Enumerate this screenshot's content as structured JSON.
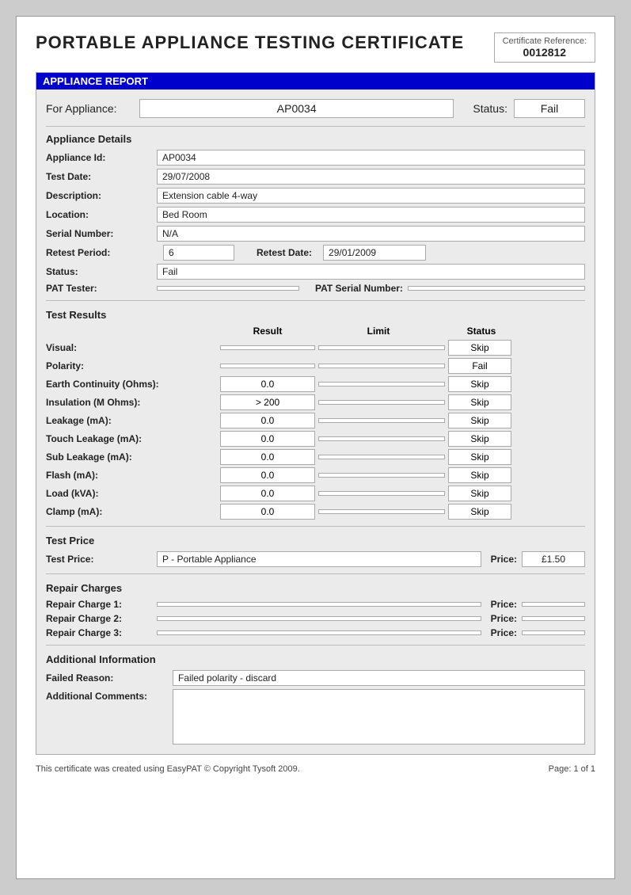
{
  "page": {
    "main_title": "PORTABLE APPLIANCE TESTING CERTIFICATE",
    "cert_ref_label": "Certificate Reference:",
    "cert_ref_value": "0012812",
    "footer_left": "This certificate was created using EasyPAT © Copyright Tysoft 2009.",
    "footer_right": "Page: 1 of 1"
  },
  "appliance_report": {
    "section_header": "APPLIANCE REPORT",
    "for_appliance_label": "For Appliance:",
    "for_appliance_value": "AP0034",
    "status_label": "Status:",
    "status_value": "Fail",
    "details_title": "Appliance Details",
    "appliance_id_label": "Appliance Id:",
    "appliance_id_value": "AP0034",
    "test_date_label": "Test Date:",
    "test_date_value": "29/07/2008",
    "description_label": "Description:",
    "description_value": "Extension cable 4-way",
    "location_label": "Location:",
    "location_value": "Bed Room",
    "serial_number_label": "Serial Number:",
    "serial_number_value": "N/A",
    "retest_period_label": "Retest Period:",
    "retest_period_value": "6",
    "retest_date_label": "Retest Date:",
    "retest_date_value": "29/01/2009",
    "status_field_label": "Status:",
    "status_field_value": "Fail",
    "pat_tester_label": "PAT Tester:",
    "pat_tester_value": "",
    "pat_serial_label": "PAT Serial Number:",
    "pat_serial_value": ""
  },
  "test_results": {
    "section_title": "Test Results",
    "col_result": "Result",
    "col_limit": "Limit",
    "col_status": "Status",
    "rows": [
      {
        "label": "Visual:",
        "result": "",
        "limit": "",
        "status": "Skip"
      },
      {
        "label": "Polarity:",
        "result": "",
        "limit": "",
        "status": "Fail"
      },
      {
        "label": "Earth Continuity (Ohms):",
        "result": "0.0",
        "limit": "",
        "status": "Skip"
      },
      {
        "label": "Insulation (M Ohms):",
        "result": "> 200",
        "limit": "",
        "status": "Skip"
      },
      {
        "label": "Leakage (mA):",
        "result": "0.0",
        "limit": "",
        "status": "Skip"
      },
      {
        "label": "Touch Leakage (mA):",
        "result": "0.0",
        "limit": "",
        "status": "Skip"
      },
      {
        "label": "Sub Leakage (mA):",
        "result": "0.0",
        "limit": "",
        "status": "Skip"
      },
      {
        "label": "Flash (mA):",
        "result": "0.0",
        "limit": "",
        "status": "Skip"
      },
      {
        "label": "Load (kVA):",
        "result": "0.0",
        "limit": "",
        "status": "Skip"
      },
      {
        "label": "Clamp (mA):",
        "result": "0.0",
        "limit": "",
        "status": "Skip"
      }
    ]
  },
  "test_price": {
    "section_title": "Test Price",
    "test_price_label": "Test Price:",
    "test_price_value": "P - Portable Appliance",
    "price_label": "Price:",
    "price_value": "£1.50"
  },
  "repair_charges": {
    "section_title": "Repair Charges",
    "charges": [
      {
        "label": "Repair Charge 1:",
        "desc": "",
        "price_label": "Price:",
        "price": ""
      },
      {
        "label": "Repair Charge 2:",
        "desc": "",
        "price_label": "Price:",
        "price": ""
      },
      {
        "label": "Repair Charge 3:",
        "desc": "",
        "price_label": "Price:",
        "price": ""
      }
    ]
  },
  "additional_info": {
    "section_title": "Additional Information",
    "failed_reason_label": "Failed Reason:",
    "failed_reason_value": "Failed polarity - discard",
    "additional_comments_label": "Additional Comments:",
    "additional_comments_value": ""
  }
}
